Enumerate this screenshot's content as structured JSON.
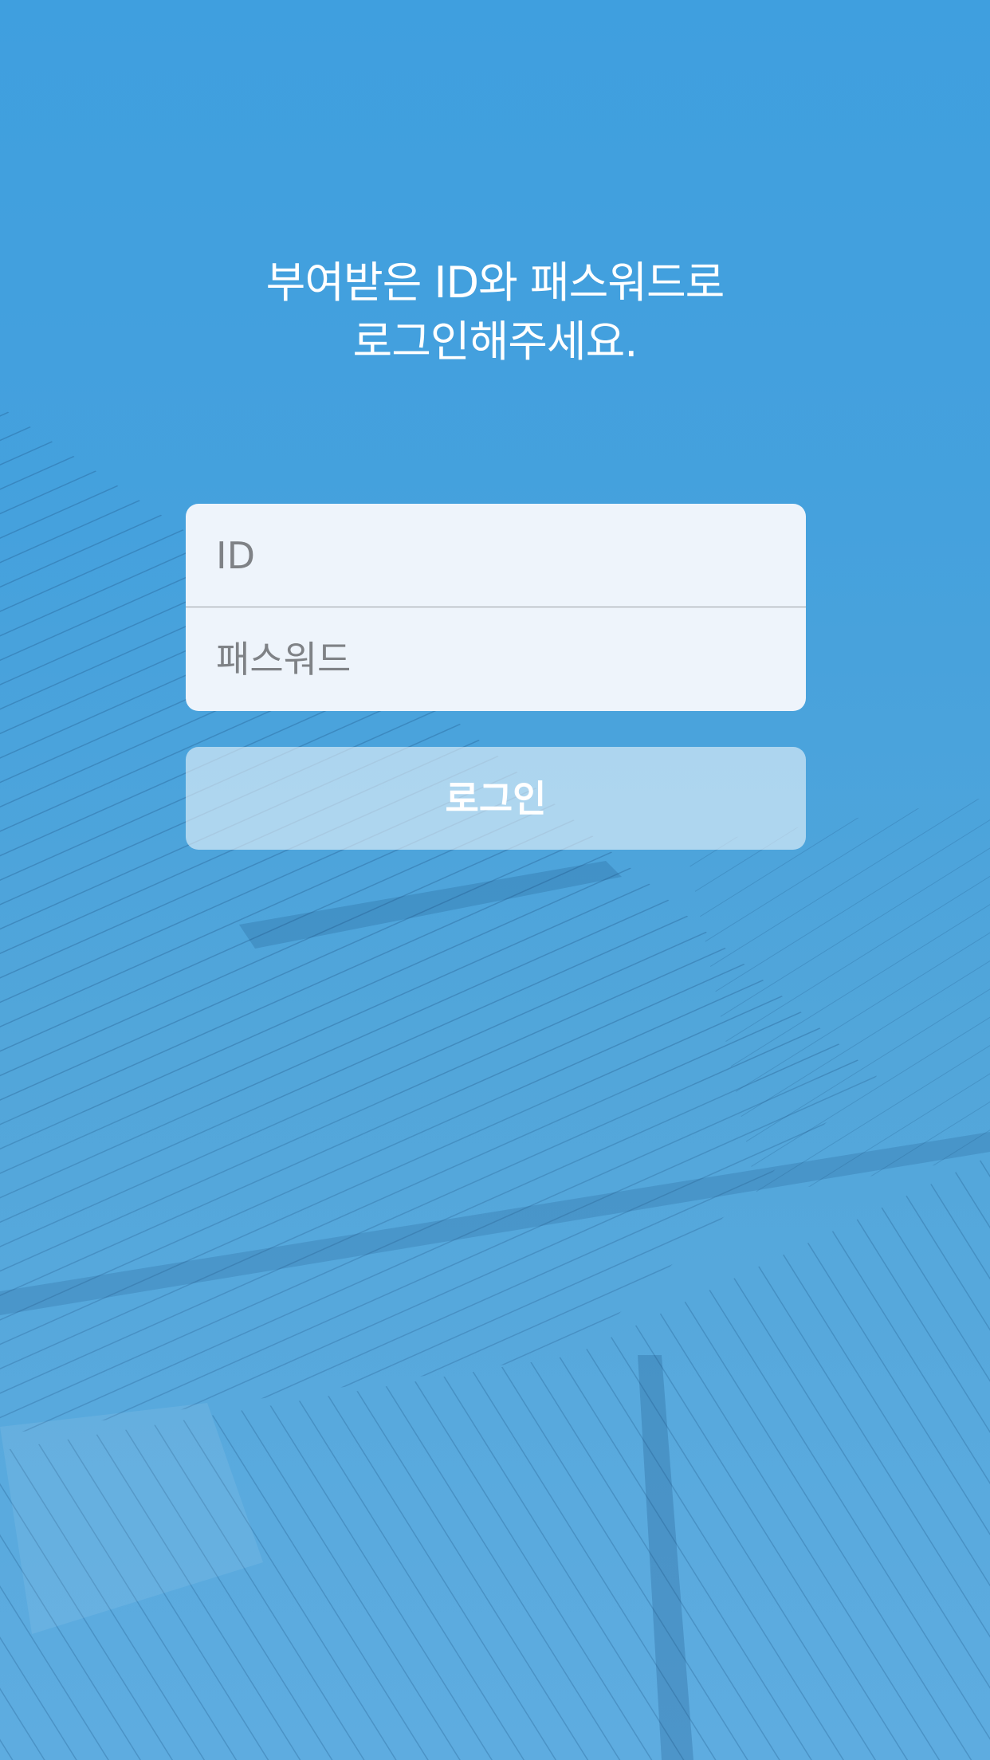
{
  "colors": {
    "background": "#3f9ede",
    "headline_text": "#ffffff",
    "field_background": "#eef4fb",
    "placeholder_text": "#7f8286",
    "button_text": "#ffffff"
  },
  "login": {
    "headline_line1": "부여받은 ID와 패스워드로",
    "headline_line2": "로그인해주세요.",
    "id_placeholder": "ID",
    "password_placeholder": "패스워드",
    "submit_label": "로그인"
  }
}
